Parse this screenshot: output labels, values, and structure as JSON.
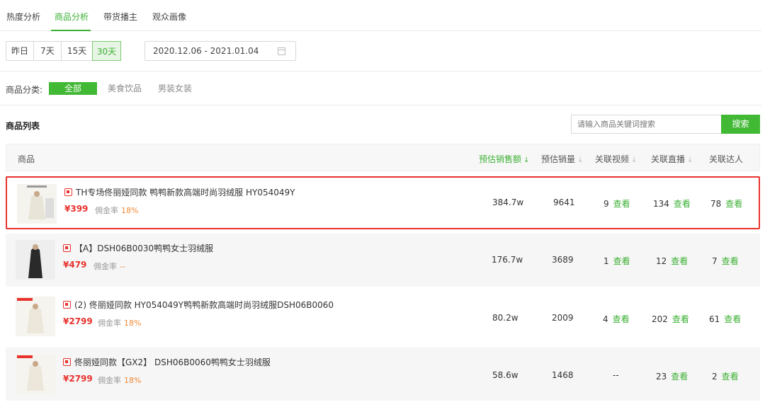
{
  "tabs": [
    {
      "label": "热度分析"
    },
    {
      "label": "商品分析"
    },
    {
      "label": "带货播主"
    },
    {
      "label": "观众画像"
    }
  ],
  "date_range": {
    "options": [
      "昨日",
      "7天",
      "15天",
      "30天"
    ],
    "selected": "30天",
    "value": "2020.12.06 - 2021.01.04"
  },
  "category": {
    "label": "商品分类:",
    "options": [
      "全部",
      "美食饮品",
      "男装女装"
    ],
    "selected": "全部"
  },
  "list": {
    "title": "商品列表",
    "search_placeholder": "请输入商品关键词搜索",
    "search_button": "搜索",
    "headers": {
      "product": "商品",
      "sales_amount": "预估销售额",
      "sales_volume": "预估销量",
      "videos": "关联视频",
      "lives": "关联直播",
      "influencers": "关联达人"
    },
    "commission_label": "佣金率",
    "view_label": "查看",
    "rows": [
      {
        "title": "TH专场佟丽娅同款 鸭鸭新款高端时尚羽绒服 HY054049Y",
        "price": "¥399",
        "commission": "18%",
        "sales_amount": "384.7w",
        "sales_volume": "9641",
        "videos": "9",
        "lives": "134",
        "influencers": "78"
      },
      {
        "title": "【A】DSH06B0030鸭鸭女士羽绒服",
        "price": "¥479",
        "commission": "--",
        "sales_amount": "176.7w",
        "sales_volume": "3689",
        "videos": "1",
        "lives": "12",
        "influencers": "7"
      },
      {
        "title": "(2) 佟丽娅同款 HY054049Y鸭鸭新款高端时尚羽绒服DSH06B0060",
        "price": "¥2799",
        "commission": "18%",
        "sales_amount": "80.2w",
        "sales_volume": "2009",
        "videos": "4",
        "lives": "202",
        "influencers": "61"
      },
      {
        "title": "佟丽娅同款【GX2】 DSH06B0060鸭鸭女士羽绒服",
        "price": "¥2799",
        "commission": "18%",
        "sales_amount": "58.6w",
        "sales_volume": "1468",
        "videos": "--",
        "lives": "23",
        "influencers": "2"
      }
    ]
  }
}
